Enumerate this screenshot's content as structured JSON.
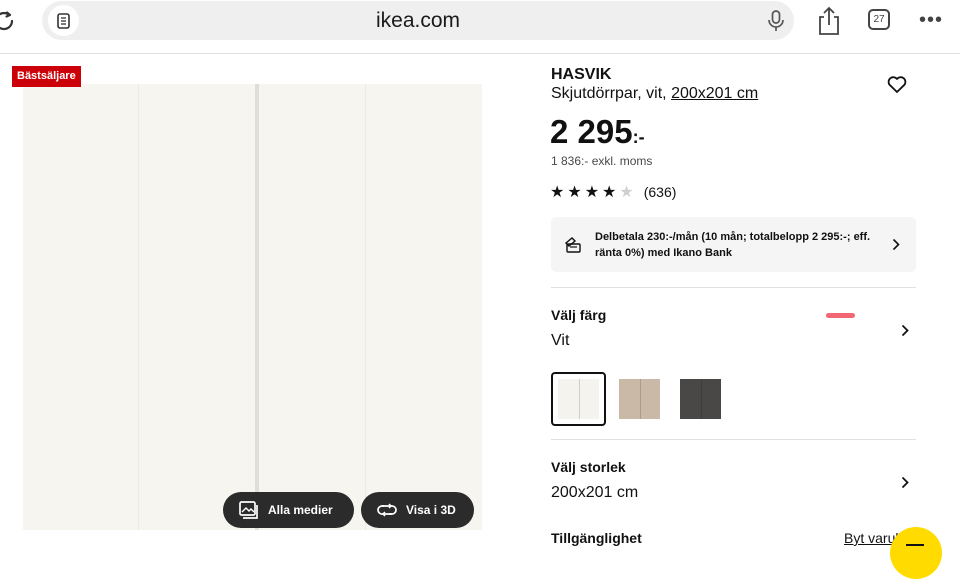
{
  "browser": {
    "url": "ikea.com",
    "tab_count": "27"
  },
  "product": {
    "badge": "Bästsäljare",
    "name": "HASVIK",
    "description": "Skjutdörrpar, vit,",
    "size_link": "200x201 cm",
    "price": "2 295",
    "price_suffix": ":-",
    "price_ex_vat": "1 836:- exkl. moms",
    "rating_value": 3.5,
    "rating_max": 5,
    "review_count": "(636)"
  },
  "installment": {
    "text": "Delbetala 230:-/mån (10 mån; totalbelopp 2 295:-; eff. ränta 0%) med Ikano Bank"
  },
  "color_section": {
    "label": "Välj färg",
    "value": "Vit",
    "swatches": [
      {
        "name": "vit",
        "color": "#f4f3ee",
        "selected": true
      },
      {
        "name": "beige",
        "color": "#c9b9a6",
        "selected": false
      },
      {
        "name": "mörkgrå",
        "color": "#4a4846",
        "selected": false
      }
    ]
  },
  "size_section": {
    "label": "Välj storlek",
    "value": "200x201 cm"
  },
  "availability_section": {
    "label": "Tillgänglighet",
    "change_store_link": "Byt varuh"
  },
  "media_buttons": {
    "all_media": "Alla medier",
    "view_3d": "Visa i 3D"
  },
  "colors": {
    "brand_red": "#cc0008",
    "ikea_yellow": "#ffdb00",
    "dark_button": "#2b2b2b"
  }
}
